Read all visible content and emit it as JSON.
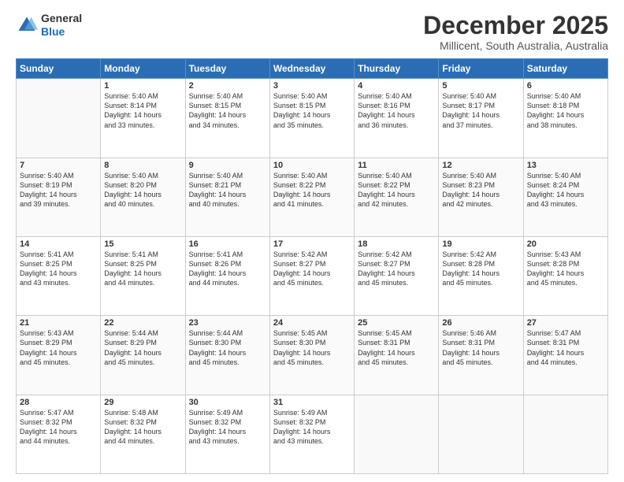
{
  "header": {
    "logo_line1": "General",
    "logo_line2": "Blue",
    "title": "December 2025",
    "subtitle": "Millicent, South Australia, Australia"
  },
  "days_of_week": [
    "Sunday",
    "Monday",
    "Tuesday",
    "Wednesday",
    "Thursday",
    "Friday",
    "Saturday"
  ],
  "weeks": [
    [
      {
        "day": "",
        "info": ""
      },
      {
        "day": "1",
        "info": "Sunrise: 5:40 AM\nSunset: 8:14 PM\nDaylight: 14 hours\nand 33 minutes."
      },
      {
        "day": "2",
        "info": "Sunrise: 5:40 AM\nSunset: 8:15 PM\nDaylight: 14 hours\nand 34 minutes."
      },
      {
        "day": "3",
        "info": "Sunrise: 5:40 AM\nSunset: 8:15 PM\nDaylight: 14 hours\nand 35 minutes."
      },
      {
        "day": "4",
        "info": "Sunrise: 5:40 AM\nSunset: 8:16 PM\nDaylight: 14 hours\nand 36 minutes."
      },
      {
        "day": "5",
        "info": "Sunrise: 5:40 AM\nSunset: 8:17 PM\nDaylight: 14 hours\nand 37 minutes."
      },
      {
        "day": "6",
        "info": "Sunrise: 5:40 AM\nSunset: 8:18 PM\nDaylight: 14 hours\nand 38 minutes."
      }
    ],
    [
      {
        "day": "7",
        "info": "Sunrise: 5:40 AM\nSunset: 8:19 PM\nDaylight: 14 hours\nand 39 minutes."
      },
      {
        "day": "8",
        "info": "Sunrise: 5:40 AM\nSunset: 8:20 PM\nDaylight: 14 hours\nand 40 minutes."
      },
      {
        "day": "9",
        "info": "Sunrise: 5:40 AM\nSunset: 8:21 PM\nDaylight: 14 hours\nand 40 minutes."
      },
      {
        "day": "10",
        "info": "Sunrise: 5:40 AM\nSunset: 8:22 PM\nDaylight: 14 hours\nand 41 minutes."
      },
      {
        "day": "11",
        "info": "Sunrise: 5:40 AM\nSunset: 8:22 PM\nDaylight: 14 hours\nand 42 minutes."
      },
      {
        "day": "12",
        "info": "Sunrise: 5:40 AM\nSunset: 8:23 PM\nDaylight: 14 hours\nand 42 minutes."
      },
      {
        "day": "13",
        "info": "Sunrise: 5:40 AM\nSunset: 8:24 PM\nDaylight: 14 hours\nand 43 minutes."
      }
    ],
    [
      {
        "day": "14",
        "info": "Sunrise: 5:41 AM\nSunset: 8:25 PM\nDaylight: 14 hours\nand 43 minutes."
      },
      {
        "day": "15",
        "info": "Sunrise: 5:41 AM\nSunset: 8:25 PM\nDaylight: 14 hours\nand 44 minutes."
      },
      {
        "day": "16",
        "info": "Sunrise: 5:41 AM\nSunset: 8:26 PM\nDaylight: 14 hours\nand 44 minutes."
      },
      {
        "day": "17",
        "info": "Sunrise: 5:42 AM\nSunset: 8:27 PM\nDaylight: 14 hours\nand 45 minutes."
      },
      {
        "day": "18",
        "info": "Sunrise: 5:42 AM\nSunset: 8:27 PM\nDaylight: 14 hours\nand 45 minutes."
      },
      {
        "day": "19",
        "info": "Sunrise: 5:42 AM\nSunset: 8:28 PM\nDaylight: 14 hours\nand 45 minutes."
      },
      {
        "day": "20",
        "info": "Sunrise: 5:43 AM\nSunset: 8:28 PM\nDaylight: 14 hours\nand 45 minutes."
      }
    ],
    [
      {
        "day": "21",
        "info": "Sunrise: 5:43 AM\nSunset: 8:29 PM\nDaylight: 14 hours\nand 45 minutes."
      },
      {
        "day": "22",
        "info": "Sunrise: 5:44 AM\nSunset: 8:29 PM\nDaylight: 14 hours\nand 45 minutes."
      },
      {
        "day": "23",
        "info": "Sunrise: 5:44 AM\nSunset: 8:30 PM\nDaylight: 14 hours\nand 45 minutes."
      },
      {
        "day": "24",
        "info": "Sunrise: 5:45 AM\nSunset: 8:30 PM\nDaylight: 14 hours\nand 45 minutes."
      },
      {
        "day": "25",
        "info": "Sunrise: 5:45 AM\nSunset: 8:31 PM\nDaylight: 14 hours\nand 45 minutes."
      },
      {
        "day": "26",
        "info": "Sunrise: 5:46 AM\nSunset: 8:31 PM\nDaylight: 14 hours\nand 45 minutes."
      },
      {
        "day": "27",
        "info": "Sunrise: 5:47 AM\nSunset: 8:31 PM\nDaylight: 14 hours\nand 44 minutes."
      }
    ],
    [
      {
        "day": "28",
        "info": "Sunrise: 5:47 AM\nSunset: 8:32 PM\nDaylight: 14 hours\nand 44 minutes."
      },
      {
        "day": "29",
        "info": "Sunrise: 5:48 AM\nSunset: 8:32 PM\nDaylight: 14 hours\nand 44 minutes."
      },
      {
        "day": "30",
        "info": "Sunrise: 5:49 AM\nSunset: 8:32 PM\nDaylight: 14 hours\nand 43 minutes."
      },
      {
        "day": "31",
        "info": "Sunrise: 5:49 AM\nSunset: 8:32 PM\nDaylight: 14 hours\nand 43 minutes."
      },
      {
        "day": "",
        "info": ""
      },
      {
        "day": "",
        "info": ""
      },
      {
        "day": "",
        "info": ""
      }
    ]
  ]
}
